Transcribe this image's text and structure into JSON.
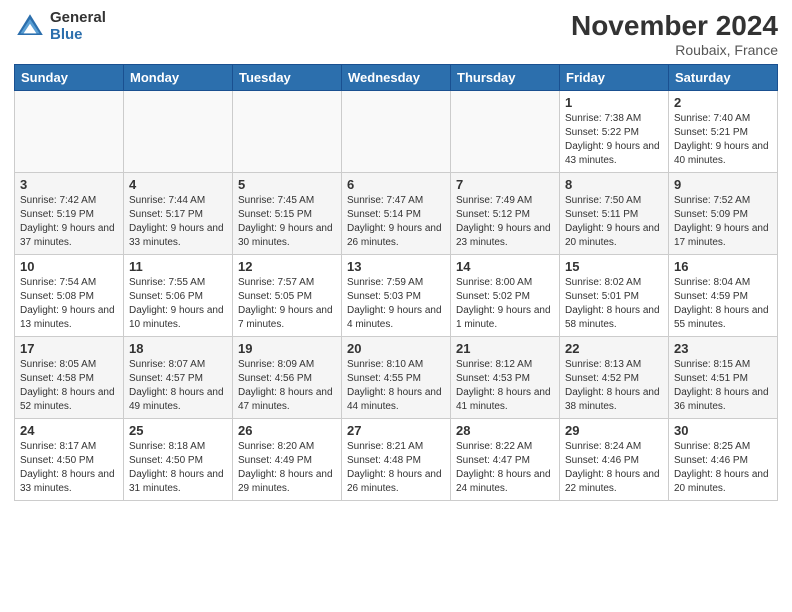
{
  "header": {
    "logo_general": "General",
    "logo_blue": "Blue",
    "title": "November 2024",
    "location": "Roubaix, France"
  },
  "columns": [
    "Sunday",
    "Monday",
    "Tuesday",
    "Wednesday",
    "Thursday",
    "Friday",
    "Saturday"
  ],
  "weeks": [
    [
      {
        "day": "",
        "info": ""
      },
      {
        "day": "",
        "info": ""
      },
      {
        "day": "",
        "info": ""
      },
      {
        "day": "",
        "info": ""
      },
      {
        "day": "",
        "info": ""
      },
      {
        "day": "1",
        "info": "Sunrise: 7:38 AM\nSunset: 5:22 PM\nDaylight: 9 hours and 43 minutes."
      },
      {
        "day": "2",
        "info": "Sunrise: 7:40 AM\nSunset: 5:21 PM\nDaylight: 9 hours and 40 minutes."
      }
    ],
    [
      {
        "day": "3",
        "info": "Sunrise: 7:42 AM\nSunset: 5:19 PM\nDaylight: 9 hours and 37 minutes."
      },
      {
        "day": "4",
        "info": "Sunrise: 7:44 AM\nSunset: 5:17 PM\nDaylight: 9 hours and 33 minutes."
      },
      {
        "day": "5",
        "info": "Sunrise: 7:45 AM\nSunset: 5:15 PM\nDaylight: 9 hours and 30 minutes."
      },
      {
        "day": "6",
        "info": "Sunrise: 7:47 AM\nSunset: 5:14 PM\nDaylight: 9 hours and 26 minutes."
      },
      {
        "day": "7",
        "info": "Sunrise: 7:49 AM\nSunset: 5:12 PM\nDaylight: 9 hours and 23 minutes."
      },
      {
        "day": "8",
        "info": "Sunrise: 7:50 AM\nSunset: 5:11 PM\nDaylight: 9 hours and 20 minutes."
      },
      {
        "day": "9",
        "info": "Sunrise: 7:52 AM\nSunset: 5:09 PM\nDaylight: 9 hours and 17 minutes."
      }
    ],
    [
      {
        "day": "10",
        "info": "Sunrise: 7:54 AM\nSunset: 5:08 PM\nDaylight: 9 hours and 13 minutes."
      },
      {
        "day": "11",
        "info": "Sunrise: 7:55 AM\nSunset: 5:06 PM\nDaylight: 9 hours and 10 minutes."
      },
      {
        "day": "12",
        "info": "Sunrise: 7:57 AM\nSunset: 5:05 PM\nDaylight: 9 hours and 7 minutes."
      },
      {
        "day": "13",
        "info": "Sunrise: 7:59 AM\nSunset: 5:03 PM\nDaylight: 9 hours and 4 minutes."
      },
      {
        "day": "14",
        "info": "Sunrise: 8:00 AM\nSunset: 5:02 PM\nDaylight: 9 hours and 1 minute."
      },
      {
        "day": "15",
        "info": "Sunrise: 8:02 AM\nSunset: 5:01 PM\nDaylight: 8 hours and 58 minutes."
      },
      {
        "day": "16",
        "info": "Sunrise: 8:04 AM\nSunset: 4:59 PM\nDaylight: 8 hours and 55 minutes."
      }
    ],
    [
      {
        "day": "17",
        "info": "Sunrise: 8:05 AM\nSunset: 4:58 PM\nDaylight: 8 hours and 52 minutes."
      },
      {
        "day": "18",
        "info": "Sunrise: 8:07 AM\nSunset: 4:57 PM\nDaylight: 8 hours and 49 minutes."
      },
      {
        "day": "19",
        "info": "Sunrise: 8:09 AM\nSunset: 4:56 PM\nDaylight: 8 hours and 47 minutes."
      },
      {
        "day": "20",
        "info": "Sunrise: 8:10 AM\nSunset: 4:55 PM\nDaylight: 8 hours and 44 minutes."
      },
      {
        "day": "21",
        "info": "Sunrise: 8:12 AM\nSunset: 4:53 PM\nDaylight: 8 hours and 41 minutes."
      },
      {
        "day": "22",
        "info": "Sunrise: 8:13 AM\nSunset: 4:52 PM\nDaylight: 8 hours and 38 minutes."
      },
      {
        "day": "23",
        "info": "Sunrise: 8:15 AM\nSunset: 4:51 PM\nDaylight: 8 hours and 36 minutes."
      }
    ],
    [
      {
        "day": "24",
        "info": "Sunrise: 8:17 AM\nSunset: 4:50 PM\nDaylight: 8 hours and 33 minutes."
      },
      {
        "day": "25",
        "info": "Sunrise: 8:18 AM\nSunset: 4:50 PM\nDaylight: 8 hours and 31 minutes."
      },
      {
        "day": "26",
        "info": "Sunrise: 8:20 AM\nSunset: 4:49 PM\nDaylight: 8 hours and 29 minutes."
      },
      {
        "day": "27",
        "info": "Sunrise: 8:21 AM\nSunset: 4:48 PM\nDaylight: 8 hours and 26 minutes."
      },
      {
        "day": "28",
        "info": "Sunrise: 8:22 AM\nSunset: 4:47 PM\nDaylight: 8 hours and 24 minutes."
      },
      {
        "day": "29",
        "info": "Sunrise: 8:24 AM\nSunset: 4:46 PM\nDaylight: 8 hours and 22 minutes."
      },
      {
        "day": "30",
        "info": "Sunrise: 8:25 AM\nSunset: 4:46 PM\nDaylight: 8 hours and 20 minutes."
      }
    ]
  ]
}
